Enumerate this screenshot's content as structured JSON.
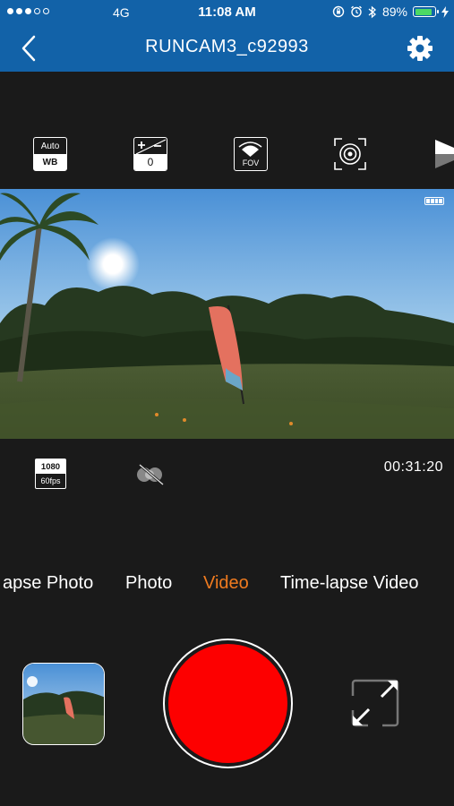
{
  "status_bar": {
    "signal_dots": [
      true,
      true,
      true,
      false,
      false
    ],
    "carrier": "4G",
    "time": "11:08 AM",
    "battery_percent_label": "89%",
    "battery_level": 0.89,
    "icons": [
      "rotation-lock-icon",
      "alarm-icon",
      "bluetooth-icon",
      "battery-icon",
      "charging-bolt-icon"
    ]
  },
  "nav": {
    "title": "RUNCAM3_c92993",
    "back_icon": "chevron-left-icon",
    "settings_icon": "gear-icon"
  },
  "toolbar": {
    "white_balance": {
      "top": "Auto",
      "bottom": "WB"
    },
    "exposure": {
      "value": "0"
    },
    "fov": {
      "label": "FOV"
    },
    "focus_icon": "target-icon",
    "more_icon": "triangle-icon"
  },
  "preview": {
    "battery_bars": 4
  },
  "info": {
    "resolution": "1080",
    "framerate": "60fps",
    "link_icon": "link-off-icon",
    "record_time": "00:31:20"
  },
  "modes": {
    "items": [
      "apse Photo",
      "Photo",
      "Video",
      "Time-lapse Video"
    ],
    "active": "Video"
  },
  "controls": {
    "gallery_icon": "gallery-thumbnail",
    "shutter_color": "#fd0000",
    "fullscreen_icon": "expand-icon"
  },
  "colors": {
    "header": "#1262a8",
    "background": "#1a1a1a",
    "active_mode": "#f07b1f"
  }
}
